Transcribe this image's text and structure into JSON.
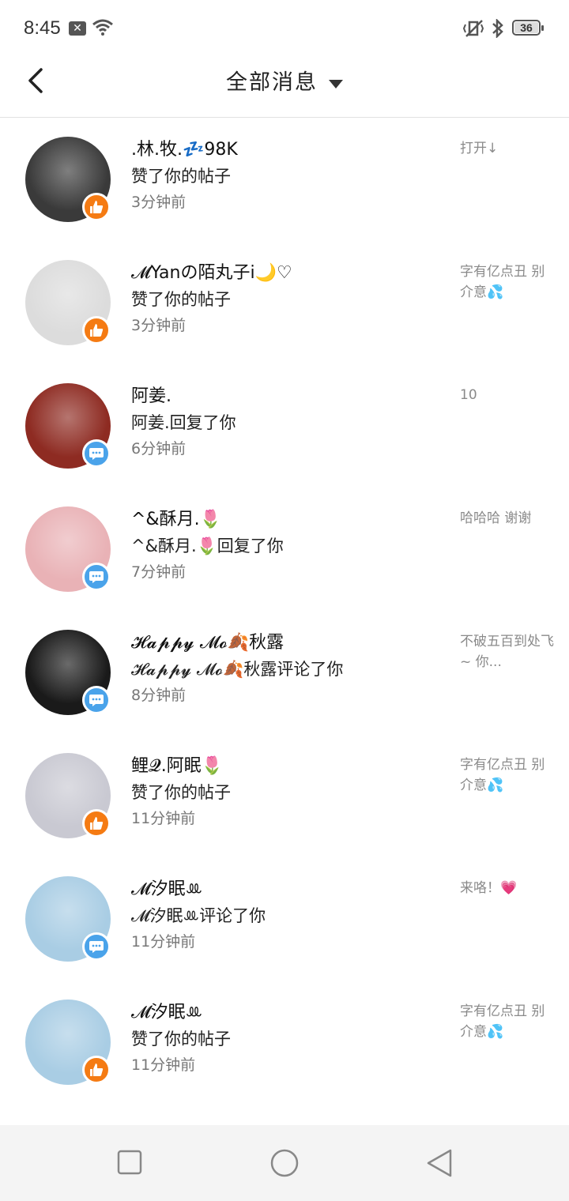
{
  "status_bar": {
    "time": "8:45",
    "battery": "36"
  },
  "header": {
    "title": "全部消息"
  },
  "messages": [
    {
      "name": ".林.牧.💤98K",
      "action": "赞了你的帖子",
      "time": "3分钟前",
      "snippet": "打开↓",
      "type": "like",
      "avatar_bg": "#3a3a3a"
    },
    {
      "name": "𝓜Yanの陌丸子i🌙♡",
      "action": "赞了你的帖子",
      "time": "3分钟前",
      "snippet": "字有亿点丑 别介意💦",
      "type": "like",
      "avatar_bg": "#dcdcdc"
    },
    {
      "name": "阿姜.",
      "action": "阿姜.回复了你",
      "time": "6分钟前",
      "snippet": "10",
      "type": "comment",
      "avatar_bg": "#8e2b22"
    },
    {
      "name": "^&酥月.🌷",
      "action": "^&酥月.🌷回复了你",
      "time": "7分钟前",
      "snippet": "哈哈哈 谢谢",
      "type": "comment",
      "avatar_bg": "#e9b2b6"
    },
    {
      "name": "𝓗𝓪𝓹𝓹𝔂 𝓜𝓸🍂秋露",
      "action": "𝓗𝓪𝓹𝓹𝔂 𝓜𝓸🍂秋露评论了你",
      "time": "8分钟前",
      "snippet": "不破五百到处飞~ 你...",
      "type": "comment",
      "avatar_bg": "#1a1a1a"
    },
    {
      "name": "鲤𝓠.阿眠🌷",
      "action": "赞了你的帖子",
      "time": "11分钟前",
      "snippet": "字有亿点丑 别介意💦",
      "type": "like",
      "avatar_bg": "#c9c9d2"
    },
    {
      "name": "𝓜汐眠ꔛ",
      "action": "𝓜汐眠ꔛ评论了你",
      "time": "11分钟前",
      "snippet": "来咯！💗",
      "type": "comment",
      "avatar_bg": "#a9cde4"
    },
    {
      "name": "𝓜汐眠ꔛ",
      "action": "赞了你的帖子",
      "time": "11分钟前",
      "snippet": "字有亿点丑 别介意💦",
      "type": "like",
      "avatar_bg": "#a9cde4"
    }
  ],
  "colors": {
    "like_badge": "#f57b13",
    "comment_badge": "#4aa3ea"
  },
  "nav_icons": [
    "square-icon",
    "circle-icon",
    "triangle-back-icon"
  ]
}
